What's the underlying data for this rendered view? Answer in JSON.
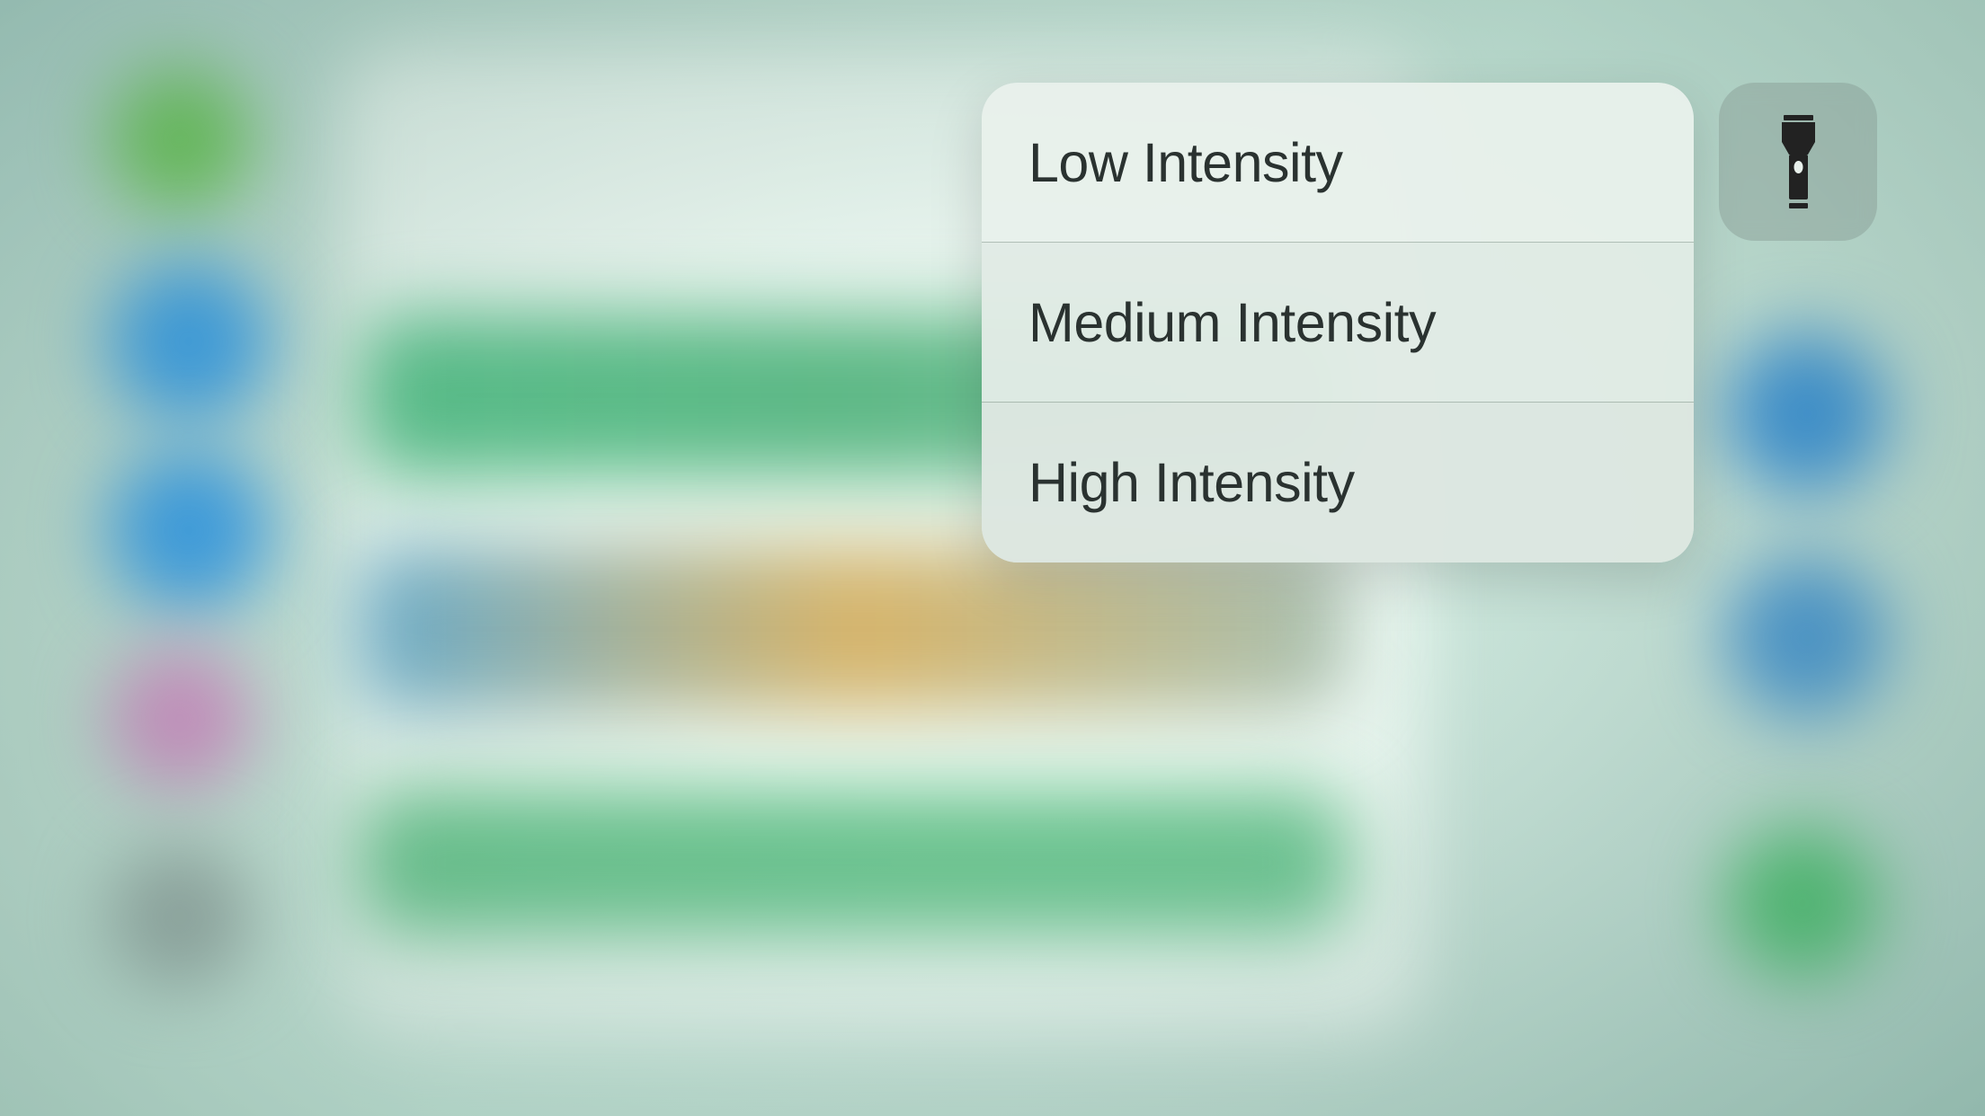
{
  "context_menu": {
    "items": [
      {
        "label": "Low Intensity"
      },
      {
        "label": "Medium Intensity"
      },
      {
        "label": "High Intensity"
      }
    ]
  },
  "icon": {
    "name": "flashlight-icon"
  }
}
